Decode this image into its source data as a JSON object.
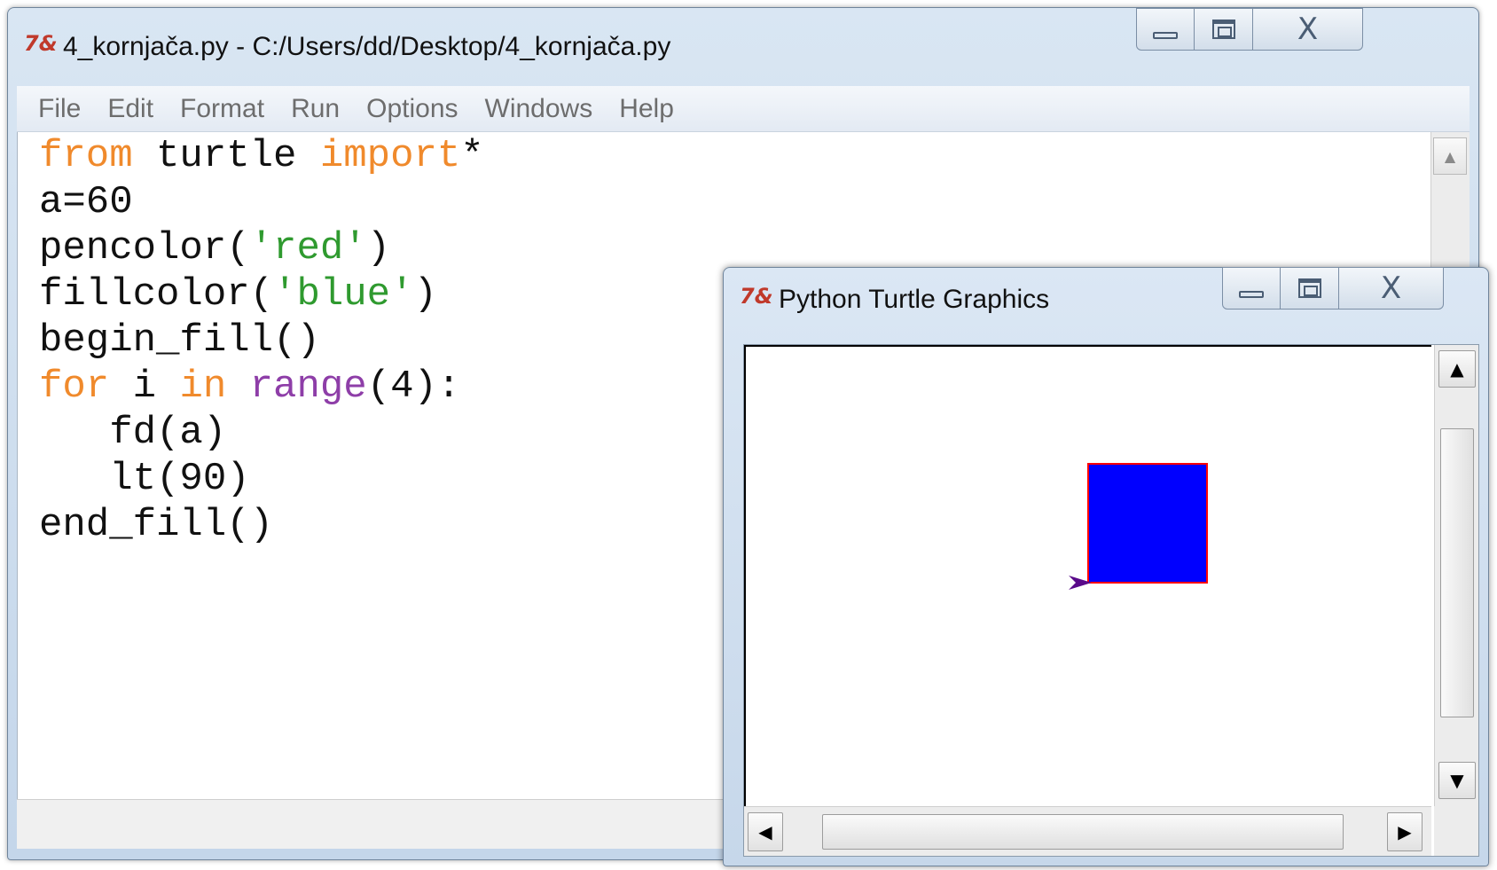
{
  "editor_window": {
    "icon": "python-idle-icon",
    "icon_text": "7&",
    "title": "4_kornjača.py - C:/Users/dd/Desktop/4_kornjača.py",
    "controls": {
      "minimize": "minimize-icon",
      "maximize": "maximize-icon",
      "close": "close-icon",
      "close_glyph": "X"
    },
    "menu": [
      "File",
      "Edit",
      "Format",
      "Run",
      "Options",
      "Windows",
      "Help"
    ],
    "code": [
      [
        {
          "t": "from",
          "c": "kw"
        },
        {
          "t": " turtle ",
          "c": ""
        },
        {
          "t": "import",
          "c": "kw"
        },
        {
          "t": "*",
          "c": ""
        }
      ],
      [
        {
          "t": "a=60",
          "c": ""
        }
      ],
      [
        {
          "t": "pencolor(",
          "c": ""
        },
        {
          "t": "'red'",
          "c": "str"
        },
        {
          "t": ")",
          "c": ""
        }
      ],
      [
        {
          "t": "fillcolor(",
          "c": ""
        },
        {
          "t": "'blue'",
          "c": "str"
        },
        {
          "t": ")",
          "c": ""
        }
      ],
      [
        {
          "t": "begin_fill()",
          "c": ""
        }
      ],
      [
        {
          "t": "for",
          "c": "kw"
        },
        {
          "t": " i ",
          "c": ""
        },
        {
          "t": "in",
          "c": "kw"
        },
        {
          "t": " ",
          "c": ""
        },
        {
          "t": "range",
          "c": "bi"
        },
        {
          "t": "(4):",
          "c": ""
        }
      ],
      [
        {
          "t": "   fd(a)",
          "c": ""
        }
      ],
      [
        {
          "t": "   lt(90)",
          "c": ""
        }
      ],
      [
        {
          "t": "end_fill()",
          "c": ""
        }
      ]
    ],
    "syntax_colors": {
      "keyword": "#f08a2c",
      "string": "#2f9a2f",
      "builtin": "#8e3ea8",
      "default": "#111111"
    }
  },
  "turtle_window": {
    "icon": "python-idle-icon",
    "icon_text": "7&",
    "title": "Python Turtle Graphics",
    "controls": {
      "minimize": "minimize-icon",
      "maximize": "maximize-icon",
      "close": "close-icon",
      "close_glyph": "X"
    },
    "drawing": {
      "square_fill": "#0000ff",
      "square_outline": "#ff0000",
      "turtle_color": "#5a0a8a"
    },
    "scroll_arrows": {
      "up": "▲",
      "down": "▼",
      "left": "◀",
      "right": "▶"
    }
  }
}
